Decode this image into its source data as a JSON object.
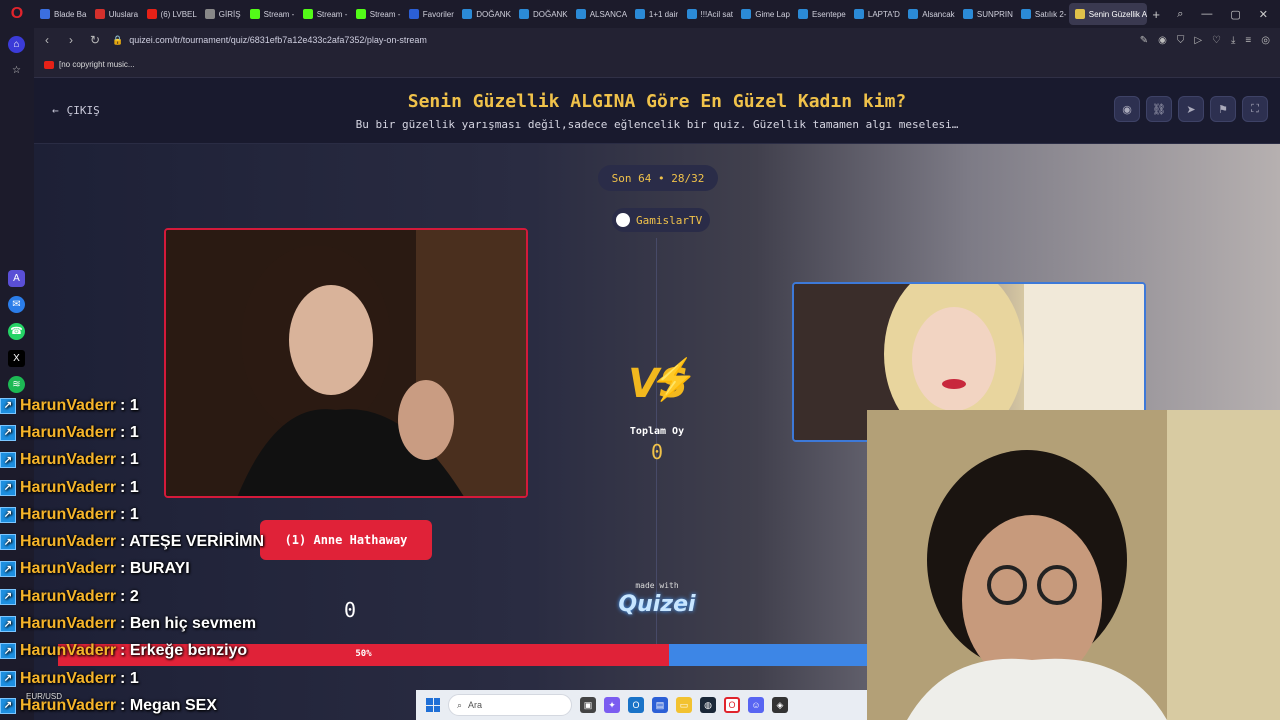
{
  "browser": {
    "logo": "O",
    "tabs": [
      {
        "label": "Blade Ba",
        "icon": "app-icon",
        "color": "#3b6fe0"
      },
      {
        "label": "Uluslara",
        "icon": "app-icon",
        "color": "#d4302c"
      },
      {
        "label": "(6) LVBEL",
        "icon": "youtube-icon",
        "color": "#e62117"
      },
      {
        "label": "GİRİŞ",
        "icon": "app-icon",
        "color": "#888888"
      },
      {
        "label": "Stream -",
        "icon": "kick-icon",
        "color": "#53fc18"
      },
      {
        "label": "Stream -",
        "icon": "kick-icon",
        "color": "#53fc18"
      },
      {
        "label": "Stream -",
        "icon": "kick-icon",
        "color": "#53fc18"
      },
      {
        "label": "Favoriler",
        "icon": "app-icon",
        "color": "#2b5fd6"
      },
      {
        "label": "DOĞANK",
        "icon": "app-icon",
        "color": "#2b8ad6"
      },
      {
        "label": "DOĞANK",
        "icon": "app-icon",
        "color": "#2b8ad6"
      },
      {
        "label": "ALSANCA",
        "icon": "app-icon",
        "color": "#2b8ad6"
      },
      {
        "label": "1+1 dair",
        "icon": "app-icon",
        "color": "#2b8ad6"
      },
      {
        "label": "!!!Acil sat",
        "icon": "app-icon",
        "color": "#2b8ad6"
      },
      {
        "label": "Gime Lap",
        "icon": "app-icon",
        "color": "#2b8ad6"
      },
      {
        "label": "Esentepe",
        "icon": "app-icon",
        "color": "#2b8ad6"
      },
      {
        "label": "LAPTA'D",
        "icon": "app-icon",
        "color": "#2b8ad6"
      },
      {
        "label": "Alsancak",
        "icon": "app-icon",
        "color": "#2b8ad6"
      },
      {
        "label": "SUNPRIN",
        "icon": "app-icon",
        "color": "#2b8ad6"
      },
      {
        "label": "Satılık 2-",
        "icon": "app-icon",
        "color": "#2b8ad6"
      },
      {
        "label": "Senin Güzellik A",
        "icon": "app-icon",
        "color": "#e0c24a",
        "active": true
      }
    ],
    "url": "quizei.com/tr/tournament/quiz/6831efb7a12e433c2afa7352/play-on-stream",
    "bookmark": "[no copyright music..."
  },
  "quiz": {
    "exit_label": "ÇIKIŞ",
    "title": "Senin Güzellik ALGINA Göre En Güzel Kadın kim?",
    "subtitle": "Bu bir güzellik yarışması değil,sadece eğlencelik bir quiz. Güzellik tamamen algı meselesi…",
    "round": "Son 64 • 28/32",
    "streamer": "GamislarTV",
    "vs": "VS",
    "total_votes_label": "Toplam Oy",
    "total_votes": "0",
    "left_choice": "(1) Anne Hathaway",
    "left_count": "0",
    "made_with": "made with",
    "brand": "Quizei",
    "progress_label": "50%",
    "progress_fraction": 0.5,
    "colors": {
      "accent": "#f0c24a",
      "left": "#e02238",
      "right": "#3d86e6"
    }
  },
  "chat": [
    {
      "user": "HarunVaderr",
      "msg": ": 1"
    },
    {
      "user": "HarunVaderr",
      "msg": ": 1"
    },
    {
      "user": "HarunVaderr",
      "msg": ": 1"
    },
    {
      "user": "HarunVaderr",
      "msg": ": 1"
    },
    {
      "user": "HarunVaderr",
      "msg": ": 1"
    },
    {
      "user": "HarunVaderr",
      "msg": ": ATEŞE VERİRİMN"
    },
    {
      "user": "HarunVaderr",
      "msg": ": BURAYI"
    },
    {
      "user": "HarunVaderr",
      "msg": ": 2"
    },
    {
      "user": "HarunVaderr",
      "msg": ": Ben hiç sevmem"
    },
    {
      "user": "HarunVaderr",
      "msg": ": Erkeğe benziyo"
    },
    {
      "user": "HarunVaderr",
      "msg": ": 1"
    },
    {
      "user": "HarunVaderr",
      "msg": ": Megan SEX"
    }
  ],
  "taskbar": {
    "search_placeholder": "Ara",
    "ticker": "EUR/USD"
  }
}
